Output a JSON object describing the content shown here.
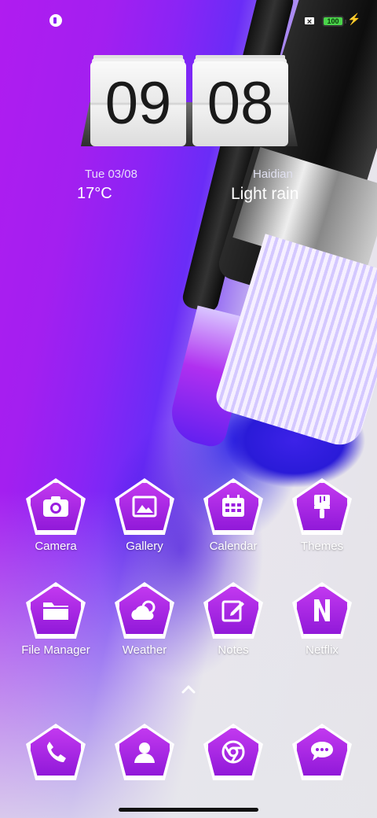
{
  "status_bar": {
    "battery": "100",
    "sim_icon": "no-sim-icon",
    "charging_icon": "bolt-icon",
    "notification_icon": "app-notification-icon"
  },
  "clock": {
    "hour": "09",
    "minute": "08"
  },
  "weather_widget": {
    "date": "Tue 03/08",
    "temperature": "17°C",
    "city": "Haidian",
    "condition": "Light rain"
  },
  "apps": [
    {
      "label": "Camera",
      "icon": "camera-icon"
    },
    {
      "label": "Gallery",
      "icon": "image-icon"
    },
    {
      "label": "Calendar",
      "icon": "calendar-icon"
    },
    {
      "label": "Themes",
      "icon": "paintbrush-icon"
    },
    {
      "label": "File Manager",
      "icon": "folder-icon"
    },
    {
      "label": "Weather",
      "icon": "cloud-sun-icon"
    },
    {
      "label": "Notes",
      "icon": "note-edit-icon"
    },
    {
      "label": "Netflix",
      "icon": "netflix-n-icon"
    }
  ],
  "dock": [
    {
      "icon": "phone-icon"
    },
    {
      "icon": "contacts-icon"
    },
    {
      "icon": "chrome-icon"
    },
    {
      "icon": "message-icon"
    }
  ],
  "colors": {
    "accent": "#a524e6",
    "wallpaper_purple": "#b01cf0",
    "wallpaper_blue": "#3c22e8"
  }
}
